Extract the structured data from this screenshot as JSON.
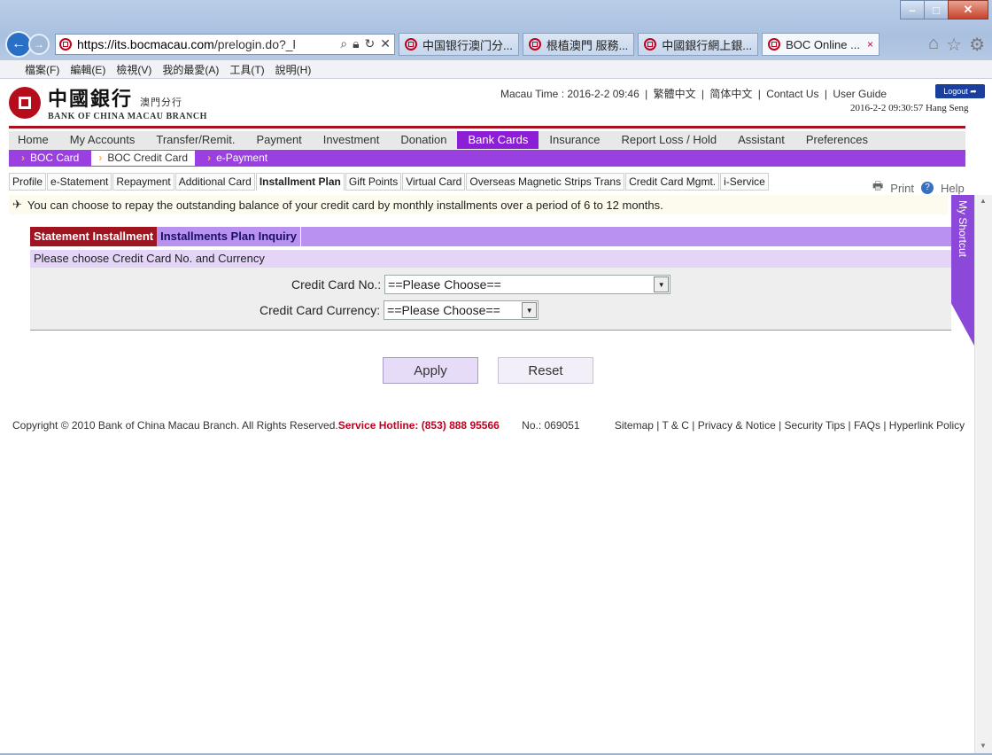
{
  "browser": {
    "url_host": "https://its.bocmacau.com",
    "url_path": "/prelogin.do?_l",
    "tabs": [
      "中国银行澳门分...",
      "根植澳門 服務...",
      "中國銀行網上銀...",
      "BOC Online ..."
    ],
    "tab_close": "×",
    "menu": [
      "檔案(F)",
      "編輯(E)",
      "檢視(V)",
      "我的最愛(A)",
      "工具(T)",
      "說明(H)"
    ]
  },
  "header": {
    "logo_cn": "中國銀行",
    "logo_branch_cn": "澳門分行",
    "logo_en": "BANK OF CHINA  MACAU BRANCH",
    "macau_time": "Macau Time : 2016-2-2 09:46",
    "links": [
      "繁體中文",
      "简体中文",
      "Contact Us",
      "User Guide"
    ],
    "logout": "Logout",
    "stamp": "2016-2-2 09:30:57 Hang Seng"
  },
  "main_nav": [
    "Home",
    "My Accounts",
    "Transfer/Remit.",
    "Payment",
    "Investment",
    "Donation",
    "Bank Cards",
    "Insurance",
    "Report Loss / Hold",
    "Assistant",
    "Preferences"
  ],
  "sub_nav": [
    "BOC Card",
    "BOC Credit Card",
    "e-Payment"
  ],
  "tabs": [
    "Profile",
    "e-Statement",
    "Repayment",
    "Additional Card",
    "Installment Plan",
    "Gift Points",
    "Virtual Card",
    "Overseas Magnetic Strips Trans",
    "Credit Card Mgmt.",
    "i-Service"
  ],
  "print": "Print",
  "help": "Help",
  "notice": "You can choose to repay the outstanding balance of your credit card by monthly installments over a period of 6 to 12 months.",
  "shortcut": "My Shortcut",
  "panel": {
    "tab_active": "Statement Installment",
    "tab_inactive": "Installments Plan Inquiry",
    "caption": "Please choose Credit Card No. and Currency",
    "card_label": "Credit Card No.:",
    "card_value": "==Please Choose==",
    "currency_label": "Credit Card Currency:",
    "currency_value": "==Please Choose=="
  },
  "buttons": {
    "apply": "Apply",
    "reset": "Reset"
  },
  "footer": {
    "copyright": "Copyright © 2010 Bank of China Macau Branch. All Rights Reserved.",
    "hotline": "Service Hotline: (853) 888 95566",
    "no": "No.: 069051",
    "links": "Sitemap | T & C | Privacy & Notice | Security Tips | FAQs | Hyperlink Policy"
  }
}
